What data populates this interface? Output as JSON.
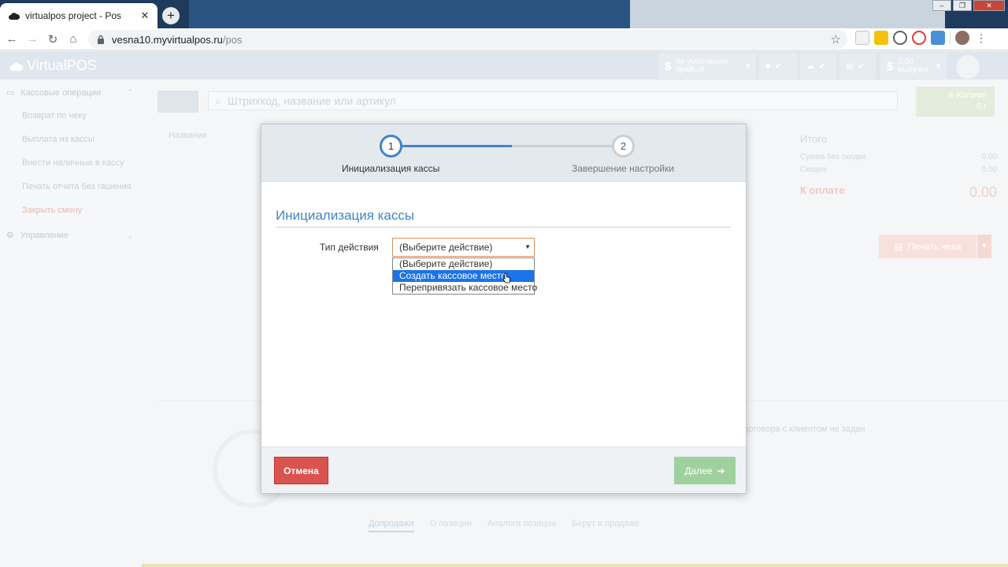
{
  "browser": {
    "tab_title": "virtualpos project - Pos",
    "url_host": "vesna10.myvirtualpos.ru",
    "url_path": "/pos",
    "tab_close": "✕",
    "new_tab": "+"
  },
  "app": {
    "logo_text": "VirtualPOS",
    "widgets": {
      "price_line1": "по умолчанию",
      "price_line2": "прайслт",
      "revenue_value": "0.00",
      "revenue_label": "выручка"
    },
    "sidebar": {
      "section1": "Кассовые операции",
      "items": [
        "Возврат по чеку",
        "Выплата из кассы",
        "Внести наличные в кассу",
        "Печать отчета без гашения",
        "Закрыть смену"
      ],
      "section2": "Управление"
    },
    "search_placeholder": "Штрихкод, название или артикул",
    "ekolimp_line1": "e-Колимп",
    "ekolimp_line2": "0 г",
    "table_header": "Название",
    "totals": {
      "title": "Итого",
      "rows": [
        {
          "label": "Сумма без скидки",
          "value": "0.00"
        },
        {
          "label": "Скидка",
          "value": "0.00"
        }
      ],
      "pay_label": "К оплате",
      "pay_value": "0.00"
    },
    "print_label": "Печать чека",
    "contract_note": "договора с клиентом не задан",
    "bottom_tabs": [
      "Допродажи",
      "О позиции",
      "Аналоги позиции",
      "Берут в продаже"
    ]
  },
  "modal": {
    "steps": [
      {
        "number": "1",
        "label": "Инициализация кассы"
      },
      {
        "number": "2",
        "label": "Завершение настройки"
      }
    ],
    "section_title": "Инициализация кассы",
    "field_label": "Тип действия",
    "select_value": "(Выберите действие)",
    "options": [
      "(Выберите действие)",
      "Создать кассовое место",
      "Перепривязать кассовое место"
    ],
    "highlighted_option": 1,
    "cancel_label": "Отмена",
    "next_label": "Далее"
  },
  "colors": {
    "accent": "#3f86c6",
    "cancel": "#d9534f",
    "next_disabled": "#9fd19f",
    "option_highlight": "#1a73e8"
  }
}
